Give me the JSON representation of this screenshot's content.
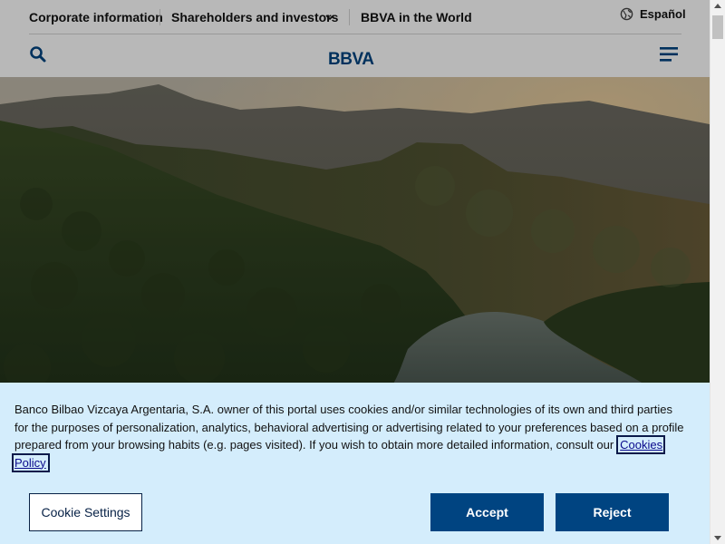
{
  "topnav": {
    "corporate": "Corporate information",
    "shareholders": "Shareholders and investors",
    "world": "BBVA in the World",
    "language": "Español"
  },
  "header": {
    "search_icon": "search-icon",
    "menu_icon": "hamburger-menu-icon",
    "logo_text": "BBVA"
  },
  "hero": {
    "description_icon": "landscape-image"
  },
  "cookie": {
    "text": "Banco Bilbao Vizcaya Argentaria, S.A. owner of this portal uses cookies and/or similar technologies of its own and third parties for the purposes of personalization, analytics, behavioral advertising or advertising related to your preferences based on a profile prepared from your browsing habits (e.g. pages visited). If you wish to obtain more detailed information, consult our",
    "link": "Cookies Policy",
    "end": ".",
    "settings_label": "Cookie Settings",
    "accept_label": "Accept",
    "reject_label": "Reject"
  },
  "colors": {
    "brand_navy": "#004481",
    "brand_dark": "#072146",
    "banner_bg": "#d4edfc"
  }
}
